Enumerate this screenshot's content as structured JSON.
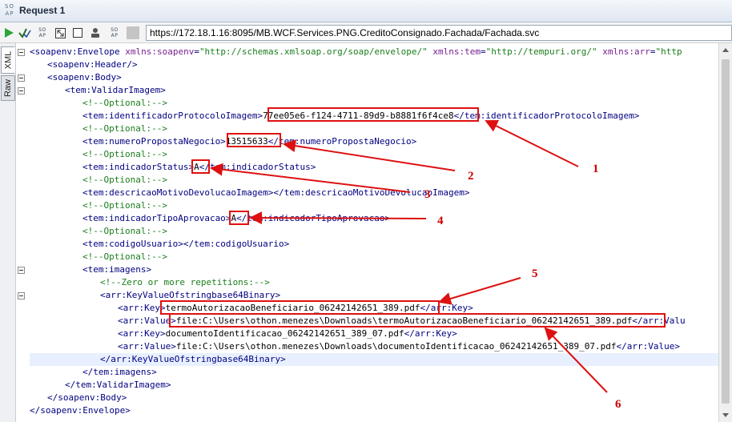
{
  "window": {
    "title": "Request 1",
    "logo_text": "SO AP"
  },
  "toolbar": {
    "endpoint": "https://172.18.1.16:8095/MB.WCF.Services.PNG.CreditoConsignado.Fachada/Fachada.svc",
    "soap_icon_text": "SO AP",
    "icons": [
      "play-icon",
      "check-icon",
      "soap-icon",
      "expand-icon",
      "stop-icon",
      "user-icon",
      "soap-icon",
      "gray-box-icon"
    ]
  },
  "tabs": [
    {
      "label": "XML",
      "active": true
    },
    {
      "label": "Raw",
      "active": false
    }
  ],
  "xml_lines": [
    {
      "indent": 0,
      "parts": [
        [
          "tag",
          "<soapenv:Envelope "
        ],
        [
          "attr",
          "xmlns:soapenv"
        ],
        [
          "tag",
          "="
        ],
        [
          "val",
          "\"http://schemas.xmlsoap.org/soap/envelope/\""
        ],
        [
          "tag",
          " "
        ],
        [
          "attr",
          "xmlns:tem"
        ],
        [
          "tag",
          "="
        ],
        [
          "val",
          "\"http://tempuri.org/\""
        ],
        [
          "tag",
          " "
        ],
        [
          "attr",
          "xmlns:arr"
        ],
        [
          "tag",
          "="
        ],
        [
          "val",
          "\"http"
        ]
      ],
      "fold": true
    },
    {
      "indent": 1,
      "parts": [
        [
          "tag",
          "<soapenv:Header/>"
        ]
      ]
    },
    {
      "indent": 1,
      "parts": [
        [
          "tag",
          "<soapenv:Body>"
        ]
      ],
      "fold": true
    },
    {
      "indent": 2,
      "parts": [
        [
          "tag",
          "<tem:ValidarImagem>"
        ]
      ],
      "fold": true
    },
    {
      "indent": 3,
      "parts": [
        [
          "cmt",
          "<!--Optional:-->"
        ]
      ]
    },
    {
      "indent": 3,
      "parts": [
        [
          "tag",
          "<tem:identificadorProtocoloImagem>"
        ],
        [
          "txt",
          "77ee05e6-f124-4711-89d9-b8881f6f4ce8"
        ],
        [
          "tag",
          "</tem:identificadorProtocoloImagem>"
        ]
      ]
    },
    {
      "indent": 3,
      "parts": [
        [
          "cmt",
          "<!--Optional:-->"
        ]
      ]
    },
    {
      "indent": 3,
      "parts": [
        [
          "tag",
          "<tem:numeroPropostaNegocio>"
        ],
        [
          "txt",
          "13515633"
        ],
        [
          "tag",
          "</tem:numeroPropostaNegocio>"
        ]
      ]
    },
    {
      "indent": 3,
      "parts": [
        [
          "cmt",
          "<!--Optional:-->"
        ]
      ]
    },
    {
      "indent": 3,
      "parts": [
        [
          "tag",
          "<tem:indicadorStatus>"
        ],
        [
          "txt",
          "A"
        ],
        [
          "tag",
          "</tem:indicadorStatus>"
        ]
      ]
    },
    {
      "indent": 3,
      "parts": [
        [
          "cmt",
          "<!--Optional:-->"
        ]
      ]
    },
    {
      "indent": 3,
      "parts": [
        [
          "tag",
          "<tem:descricaoMotivoDevolucaoImagem>"
        ],
        [
          "tag",
          "</tem:descricaoMotivoDevolucaoImagem>"
        ]
      ]
    },
    {
      "indent": 3,
      "parts": [
        [
          "cmt",
          "<!--Optional:-->"
        ]
      ]
    },
    {
      "indent": 3,
      "parts": [
        [
          "tag",
          "<tem:indicadorTipoAprovacao>"
        ],
        [
          "txt",
          "A"
        ],
        [
          "tag",
          "</tem:indicadorTipoAprovacao>"
        ]
      ]
    },
    {
      "indent": 3,
      "parts": [
        [
          "cmt",
          "<!--Optional:-->"
        ]
      ]
    },
    {
      "indent": 3,
      "parts": [
        [
          "tag",
          "<tem:codigoUsuario>"
        ],
        [
          "tag",
          "</tem:codigoUsuario>"
        ]
      ]
    },
    {
      "indent": 3,
      "parts": [
        [
          "cmt",
          "<!--Optional:-->"
        ]
      ]
    },
    {
      "indent": 3,
      "parts": [
        [
          "tag",
          "<tem:imagens>"
        ]
      ],
      "fold": true
    },
    {
      "indent": 4,
      "parts": [
        [
          "cmt",
          "<!--Zero or more repetitions:-->"
        ]
      ]
    },
    {
      "indent": 4,
      "parts": [
        [
          "tag",
          "<arr:KeyValueOfstringbase64Binary>"
        ]
      ],
      "fold": true
    },
    {
      "indent": 5,
      "parts": [
        [
          "tag",
          "<arr:Key>"
        ],
        [
          "txt",
          "termoAutorizacaoBeneficiario_06242142651_389.pdf"
        ],
        [
          "tag",
          "</arr:Key>"
        ]
      ]
    },
    {
      "indent": 5,
      "parts": [
        [
          "tag",
          "<arr:Value>"
        ],
        [
          "txt",
          "file:C:\\Users\\othon.menezes\\Downloads\\termoAutorizacaoBeneficiario_06242142651_389.pdf"
        ],
        [
          "tag",
          "</arr:Valu"
        ]
      ]
    },
    {
      "indent": 5,
      "parts": [
        [
          "tag",
          "<arr:Key>"
        ],
        [
          "txt",
          "documentoIdentificacao_06242142651_389_07.pdf"
        ],
        [
          "tag",
          "</arr:Key>"
        ]
      ]
    },
    {
      "indent": 5,
      "parts": [
        [
          "tag",
          "<arr:Value>"
        ],
        [
          "txt",
          "file:C:\\Users\\othon.menezes\\Downloads\\documentoIdentificacao_06242142651_389_07.pdf"
        ],
        [
          "tag",
          "</arr:Value>"
        ]
      ]
    },
    {
      "indent": 4,
      "parts": [
        [
          "tag",
          "</arr:KeyValueOfstringbase64Binary>"
        ]
      ],
      "current": true
    },
    {
      "indent": 3,
      "parts": [
        [
          "tag",
          "</tem:imagens>"
        ]
      ]
    },
    {
      "indent": 2,
      "parts": [
        [
          "tag",
          "</tem:ValidarImagem>"
        ]
      ]
    },
    {
      "indent": 1,
      "parts": [
        [
          "tag",
          "</soapenv:Body>"
        ]
      ]
    },
    {
      "indent": 0,
      "parts": [
        [
          "tag",
          "</soapenv:Envelope>"
        ]
      ]
    }
  ],
  "annotations": [
    "1",
    "2",
    "3",
    "4",
    "5",
    "6"
  ],
  "colors": {
    "tag": "#000080",
    "attribute": "#7a1f8f",
    "value": "#1b7d1b",
    "annotation": "#cc0000"
  }
}
